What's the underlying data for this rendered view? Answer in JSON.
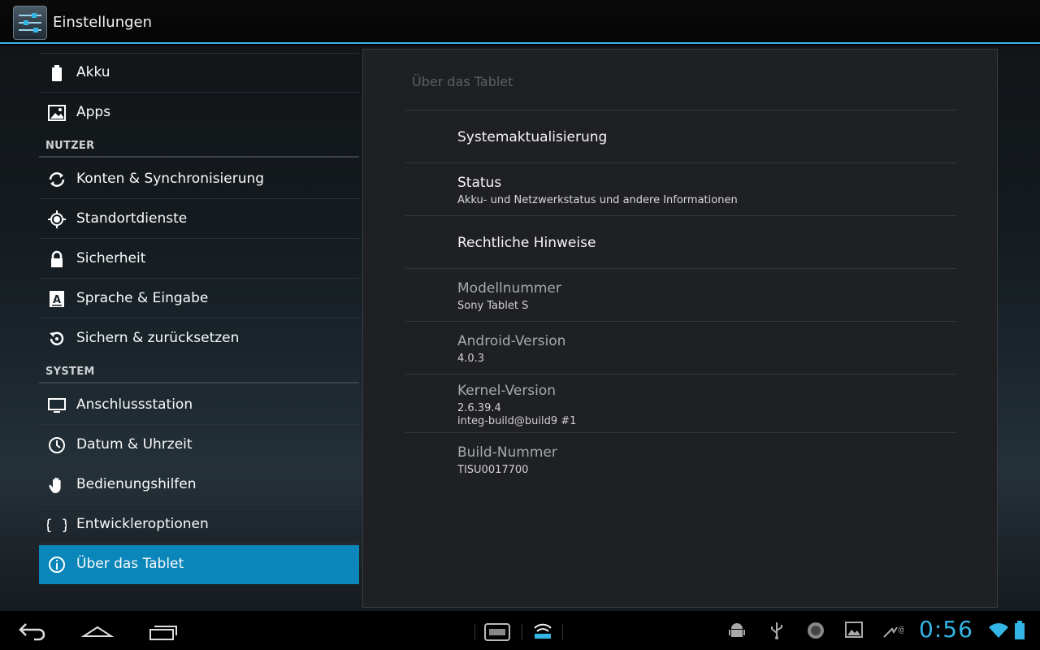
{
  "action_bar": {
    "title": "Einstellungen",
    "icon": "settings-sliders-icon"
  },
  "sidebar": {
    "items": [
      {
        "label": "Akku",
        "icon": "battery-icon"
      },
      {
        "label": "Apps",
        "icon": "apps-icon"
      },
      {
        "label": "Konten & Synchronisierung",
        "icon": "sync-icon"
      },
      {
        "label": "Standortdienste",
        "icon": "location-icon"
      },
      {
        "label": "Sicherheit",
        "icon": "lock-icon"
      },
      {
        "label": "Sprache & Eingabe",
        "icon": "language-icon"
      },
      {
        "label": "Sichern & zurücksetzen",
        "icon": "backup-icon"
      },
      {
        "label": "Anschlussstation",
        "icon": "monitor-icon"
      },
      {
        "label": "Datum & Uhrzeit",
        "icon": "clock-icon"
      },
      {
        "label": "Bedienungshilfen",
        "icon": "hand-icon"
      },
      {
        "label": "Entwickleroptionen",
        "icon": "braces-icon"
      },
      {
        "label": "Über das Tablet",
        "icon": "info-icon",
        "selected": true
      }
    ],
    "sections": {
      "nutzer": "NUTZER",
      "system": "SYSTEM"
    }
  },
  "detail": {
    "title": "Über das Tablet",
    "rows": [
      {
        "title": "Systemaktualisierung"
      },
      {
        "title": "Status",
        "summary": "Akku- und Netzwerkstatus und andere Informationen"
      },
      {
        "title": "Rechtliche Hinweise"
      },
      {
        "title": "Modellnummer",
        "summary": "Sony Tablet S"
      },
      {
        "title": "Android-Version",
        "summary": "4.0.3"
      },
      {
        "title": "Kernel-Version",
        "summary": "2.6.39.4",
        "summary2": "integ-build@build9 #1"
      },
      {
        "title": "Build-Nummer",
        "summary": "TISU0017700"
      }
    ]
  },
  "system_bar": {
    "clock": "0:56",
    "nav": [
      "back-icon",
      "home-icon",
      "recent-apps-icon"
    ],
    "tray": [
      "keyboard-icon",
      "wireless-hotspot-icon",
      "android-debug-icon",
      "usb-icon",
      "media-scan-icon",
      "screenshot-icon",
      "email-notification-icon",
      "wifi-icon",
      "battery-status-icon"
    ]
  },
  "colors": {
    "accent": "#33b5e5",
    "selected": "#0a86bb"
  }
}
